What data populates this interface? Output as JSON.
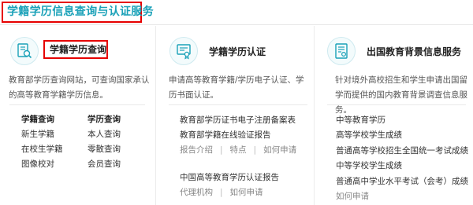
{
  "header": {
    "title": "学籍学历信息查询与认证服务"
  },
  "col1": {
    "title": "学籍学历查询",
    "icon": "document-search-icon",
    "desc": "教育部学历查询网站，可查询国家承认的高等教育学籍学历信息。",
    "sub_a": {
      "head": "学籍查询",
      "items": [
        "新生学籍",
        "在校生学籍",
        "图像校对"
      ]
    },
    "sub_b": {
      "head": "学历查询",
      "items": [
        "本人查询",
        "零散查询",
        "会员查询"
      ]
    }
  },
  "col2": {
    "title": "学籍学历认证",
    "icon": "certificate-icon",
    "desc": "申请高等教育学籍/学历电子认证、学历书面认证。",
    "block1": {
      "items": [
        "教育部学历证书电子注册备案表",
        "教育部学籍在线验证报告"
      ],
      "links": [
        "报告介绍",
        "特点",
        "如何申请"
      ]
    },
    "block2": {
      "item": "中国高等教育学历认证报告",
      "links": [
        "代理机构",
        "如何申请"
      ]
    }
  },
  "col3": {
    "title": "出国教育背景信息服务",
    "icon": "certificate-stamp-icon",
    "desc": "针对境外高校招生和学生申请出国留学而提供的国内教育背景调查信息服务。",
    "items": [
      "中等教育学历",
      "高等学校学生成绩",
      "普通高等学校招生全国统一考试成绩",
      "中等学校学生成绩",
      "普通高中学业水平考试（会考）成绩"
    ],
    "link": "如何申请"
  },
  "colors": {
    "accent": "#1aa1b8",
    "highlight_border": "#e60000"
  }
}
